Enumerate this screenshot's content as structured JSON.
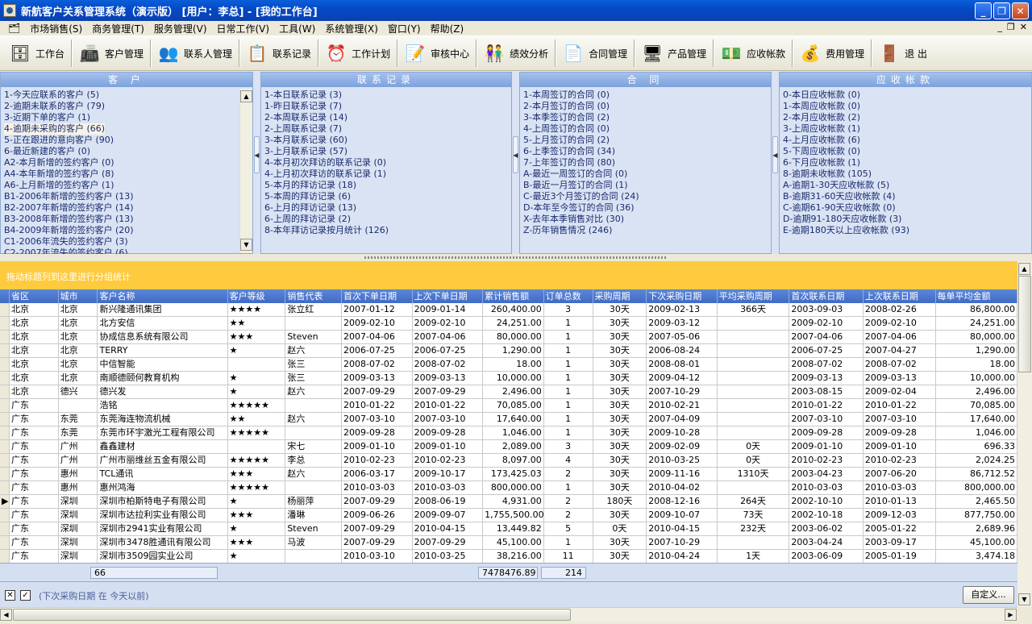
{
  "window": {
    "title": "新航客户关系管理系统（演示版）  [用户：李总]  - [我的工作台]"
  },
  "menu": [
    "市场销售(S)",
    "商务管理(T)",
    "服务管理(V)",
    "日常工作(V)",
    "工具(W)",
    "系统管理(X)",
    "窗口(Y)",
    "帮助(Z)"
  ],
  "toolbar": [
    {
      "label": "工作台",
      "icon": "desk-icon",
      "glyph": "🗄"
    },
    {
      "label": "客户管理",
      "icon": "customer-icon",
      "glyph": "📠"
    },
    {
      "label": "联系人管理",
      "icon": "contacts-icon",
      "glyph": "👥"
    },
    {
      "label": "联系记录",
      "icon": "record-icon",
      "glyph": "📋"
    },
    {
      "label": "工作计划",
      "icon": "clock-icon",
      "glyph": "⏰"
    },
    {
      "label": "审核中心",
      "icon": "audit-icon",
      "glyph": "📝"
    },
    {
      "label": "绩效分析",
      "icon": "performance-icon",
      "glyph": "👫"
    },
    {
      "label": "合同管理",
      "icon": "contract-icon",
      "glyph": "📄"
    },
    {
      "label": "产品管理",
      "icon": "product-icon",
      "glyph": "🖥"
    },
    {
      "label": "应收帐款",
      "icon": "receivable-icon",
      "glyph": "💵"
    },
    {
      "label": "费用管理",
      "icon": "expense-icon",
      "glyph": "💰"
    },
    {
      "label": "退  出",
      "icon": "exit-icon",
      "glyph": "🚪"
    }
  ],
  "panels": [
    {
      "title": "客 户",
      "items": [
        "1-今天应联系的客户 (5)",
        "2-逾期未联系的客户 (79)",
        "3-近期下单的客户 (1)",
        "4-逾期未采购的客户 (66)",
        "5-正在跟进的意向客户 (90)",
        "6-最近新建的客户 (0)",
        "A2-本月新增的签约客户 (0)",
        "A4-本年新增的签约客户 (8)",
        "A6-上月新增的签约客户 (1)",
        "B1-2006年新增的签约客户 (13)",
        "B2-2007年新增的签约客户 (14)",
        "B3-2008年新增的签约客户 (13)",
        "B4-2009年新增的签约客户 (20)",
        "C1-2006年流失的签约客户 (3)",
        "C2-2007年流失的签约客户 (6)"
      ]
    },
    {
      "title": "联系记录",
      "items": [
        "1-本日联系记录 (3)",
        "1-昨日联系记录 (7)",
        "2-本周联系记录 (14)",
        "2-上周联系记录 (7)",
        "3-本月联系记录 (60)",
        "3-上月联系记录 (57)",
        "4-本月初次拜访的联系记录 (0)",
        "4-上月初次拜访的联系记录 (1)",
        "5-本月的拜访记录 (18)",
        "5-本周的拜访记录 (6)",
        "6-上月的拜访记录 (13)",
        "6-上周的拜访记录 (2)",
        "8-本年拜访记录按月统计 (126)"
      ]
    },
    {
      "title": "合 同",
      "items": [
        "1-本周签订的合同 (0)",
        "2-本月签订的合同 (0)",
        "3-本季签订的合同 (2)",
        "4-上周签订的合同 (0)",
        "5-上月签订的合同 (2)",
        "6-上季签订的合同 (34)",
        "7-上年签订的合同 (80)",
        "A-最近一周签订的合同 (0)",
        "B-最近一月签订的合同 (1)",
        "C-最近3个月签订的合同 (24)",
        "D-本年至今签订的合同 (36)",
        "X-去年本季销售对比 (30)",
        "Z-历年销售情况 (246)"
      ]
    },
    {
      "title": "应收帐款",
      "items": [
        "0-本日应收帐款 (0)",
        "1-本周应收帐款 (0)",
        "2-本月应收帐款 (2)",
        "3-上周应收帐款 (1)",
        "4-上月应收帐款 (6)",
        "5-下周应收帐款 (0)",
        "6-下月应收帐款 (1)",
        "8-逾期未收帐款 (105)",
        "A-逾期1-30天应收帐款 (5)",
        "B-逾期31-60天应收帐款 (4)",
        "C-逾期61-90天应收帐款 (0)",
        "D-逾期91-180天应收帐款 (3)",
        "E-逾期180天以上应收帐款 (93)"
      ]
    }
  ],
  "group_hint": "拖动标题列到这里进行分组统计",
  "columns": [
    "省区",
    "城市",
    "客户名称",
    "客户等级",
    "销售代表",
    "首次下单日期",
    "上次下单日期",
    "累计销售额",
    "订单总数",
    "采购周期",
    "下次采购日期",
    "平均采购周期",
    "首次联系日期",
    "上次联系日期",
    "每单平均金额"
  ],
  "rows": [
    [
      "北京",
      "北京",
      "新兴隆通讯集团",
      "★★★★",
      "张立红",
      "2007-01-12",
      "2009-01-14",
      "260,400.00",
      "3",
      "30天",
      "2009-02-13",
      "366天",
      "2003-09-03",
      "2008-02-26",
      "86,800.00"
    ],
    [
      "北京",
      "北京",
      "北方安信",
      "★★",
      "",
      "2009-02-10",
      "2009-02-10",
      "24,251.00",
      "1",
      "30天",
      "2009-03-12",
      "",
      "2009-02-10",
      "2009-02-10",
      "24,251.00"
    ],
    [
      "北京",
      "北京",
      "协成信息系统有限公司",
      "★★★",
      "Steven",
      "2007-04-06",
      "2007-04-06",
      "80,000.00",
      "1",
      "30天",
      "2007-05-06",
      "",
      "2007-04-06",
      "2007-04-06",
      "80,000.00"
    ],
    [
      "北京",
      "北京",
      "TERRY",
      "★",
      "赵六",
      "2006-07-25",
      "2006-07-25",
      "1,290.00",
      "1",
      "30天",
      "2006-08-24",
      "",
      "2006-07-25",
      "2007-04-27",
      "1,290.00"
    ],
    [
      "北京",
      "北京",
      "中信智能",
      "",
      "张三",
      "2008-07-02",
      "2008-07-02",
      "18.00",
      "1",
      "30天",
      "2008-08-01",
      "",
      "2008-07-02",
      "2008-07-02",
      "18.00"
    ],
    [
      "北京",
      "北京",
      "南顺德颐何教育机构",
      "★",
      "张三",
      "2009-03-13",
      "2009-03-13",
      "10,000.00",
      "1",
      "30天",
      "2009-04-12",
      "",
      "2009-03-13",
      "2009-03-13",
      "10,000.00"
    ],
    [
      "北京",
      "德兴",
      "德兴发",
      "★",
      "赵六",
      "2007-09-29",
      "2007-09-29",
      "2,496.00",
      "1",
      "30天",
      "2007-10-29",
      "",
      "2003-08-15",
      "2009-02-04",
      "2,496.00"
    ],
    [
      "广东",
      "",
      "浩铭",
      "★★★★★",
      "",
      "2010-01-22",
      "2010-01-22",
      "70,085.00",
      "1",
      "30天",
      "2010-02-21",
      "",
      "2010-01-22",
      "2010-01-22",
      "70,085.00"
    ],
    [
      "广东",
      "东莞",
      "东莞海连物流机械",
      "★★",
      "赵六",
      "2007-03-10",
      "2007-03-10",
      "17,640.00",
      "1",
      "30天",
      "2007-04-09",
      "",
      "2007-03-10",
      "2007-03-10",
      "17,640.00"
    ],
    [
      "广东",
      "东莞",
      "东莞市环宇激光工程有限公司",
      "★★★★★",
      "",
      "2009-09-28",
      "2009-09-28",
      "1,046.00",
      "1",
      "30天",
      "2009-10-28",
      "",
      "2009-09-28",
      "2009-09-28",
      "1,046.00"
    ],
    [
      "广东",
      "广州",
      "鑫鑫建材",
      "",
      "宋七",
      "2009-01-10",
      "2009-01-10",
      "2,089.00",
      "3",
      "30天",
      "2009-02-09",
      "0天",
      "2009-01-10",
      "2009-01-10",
      "696.33"
    ],
    [
      "广东",
      "广州",
      "广州市丽维丝五金有限公司",
      "★★★★★",
      "李总",
      "2010-02-23",
      "2010-02-23",
      "8,097.00",
      "4",
      "30天",
      "2010-03-25",
      "0天",
      "2010-02-23",
      "2010-02-23",
      "2,024.25"
    ],
    [
      "广东",
      "惠州",
      "TCL通讯",
      "★★★",
      "赵六",
      "2006-03-17",
      "2009-10-17",
      "173,425.03",
      "2",
      "30天",
      "2009-11-16",
      "1310天",
      "2003-04-23",
      "2007-06-20",
      "86,712.52"
    ],
    [
      "广东",
      "惠州",
      "惠州鸿海",
      "★★★★★",
      "",
      "2010-03-03",
      "2010-03-03",
      "800,000.00",
      "1",
      "30天",
      "2010-04-02",
      "",
      "2010-03-03",
      "2010-03-03",
      "800,000.00"
    ],
    [
      "广东",
      "深圳",
      "深圳市柏斯特电子有限公司",
      "★",
      "杨丽萍",
      "2007-09-29",
      "2008-06-19",
      "4,931.00",
      "2",
      "180天",
      "2008-12-16",
      "264天",
      "2002-10-10",
      "2010-01-13",
      "2,465.50"
    ],
    [
      "广东",
      "深圳",
      "深圳市达拉利实业有限公司",
      "★★★",
      "潘琳",
      "2009-06-26",
      "2009-09-07",
      "1,755,500.00",
      "2",
      "30天",
      "2009-10-07",
      "73天",
      "2002-10-18",
      "2009-12-03",
      "877,750.00"
    ],
    [
      "广东",
      "深圳",
      "深圳市2941实业有限公司",
      "★",
      "Steven",
      "2007-09-29",
      "2010-04-15",
      "13,449.82",
      "5",
      "0天",
      "2010-04-15",
      "232天",
      "2003-06-02",
      "2005-01-22",
      "2,689.96"
    ],
    [
      "广东",
      "深圳",
      "深圳市3478胜通讯有限公司",
      "★★★",
      "马波",
      "2007-09-29",
      "2007-09-29",
      "45,100.00",
      "1",
      "30天",
      "2007-10-29",
      "",
      "2003-04-24",
      "2003-09-17",
      "45,100.00"
    ],
    [
      "广东",
      "深圳",
      "深圳市3509园实业公司",
      "★",
      "",
      "2010-03-10",
      "2010-03-25",
      "38,216.00",
      "11",
      "30天",
      "2010-04-24",
      "1天",
      "2003-06-09",
      "2005-01-19",
      "3,474.18"
    ]
  ],
  "selected_row": 14,
  "footer": {
    "count": "66",
    "total_sales": "7478476.89",
    "total_orders": "214"
  },
  "filter": {
    "text": "(下次采购日期 在 今天以前)",
    "custom_button": "自定义..."
  }
}
